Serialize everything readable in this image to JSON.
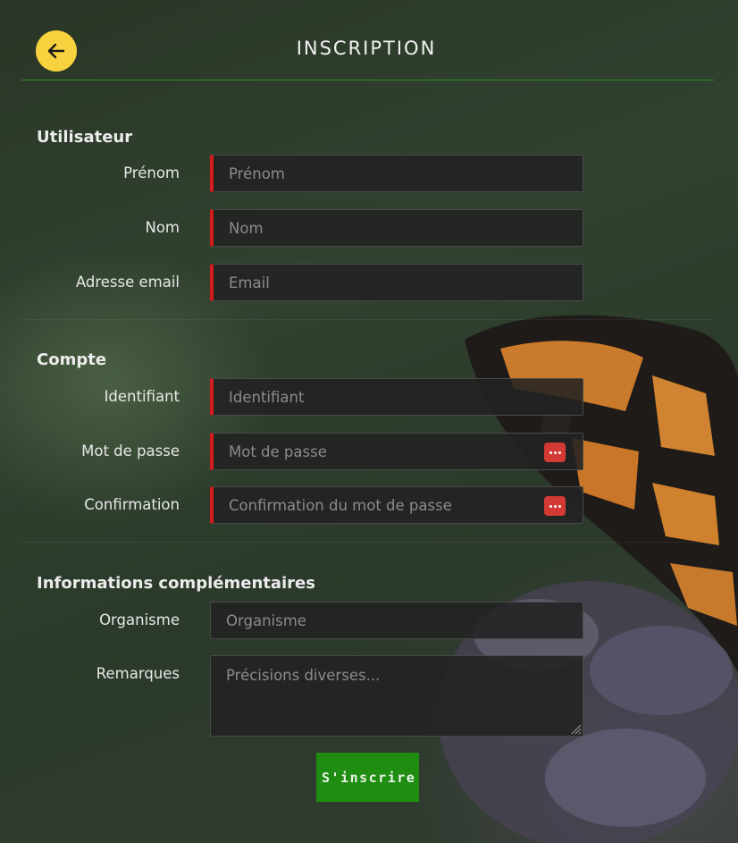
{
  "header": {
    "title": "INSCRIPTION",
    "back_icon": "arrow-left-icon"
  },
  "sections": {
    "user": {
      "title": "Utilisateur",
      "first_name": {
        "label": "Prénom",
        "placeholder": "Prénom",
        "value": ""
      },
      "last_name": {
        "label": "Nom",
        "placeholder": "Nom",
        "value": ""
      },
      "email": {
        "label": "Adresse email",
        "placeholder": "Email",
        "value": ""
      }
    },
    "account": {
      "title": "Compte",
      "login": {
        "label": "Identifiant",
        "placeholder": "Identifiant",
        "value": ""
      },
      "password": {
        "label": "Mot de passe",
        "placeholder": "Mot de passe",
        "value": ""
      },
      "confirm": {
        "label": "Confirmation",
        "placeholder": "Confirmation du mot de passe",
        "value": ""
      }
    },
    "extra": {
      "title": "Informations complémentaires",
      "organism": {
        "label": "Organisme",
        "placeholder": "Organisme",
        "value": ""
      },
      "remarks": {
        "label": "Remarques",
        "placeholder": "Précisions diverses...",
        "value": ""
      }
    }
  },
  "submit_label": "S'inscrire",
  "colors": {
    "accent_yellow": "#f7d23e",
    "submit_green": "#1f8c12",
    "required_red": "#d51b1b",
    "header_line": "#2f8a1e"
  }
}
